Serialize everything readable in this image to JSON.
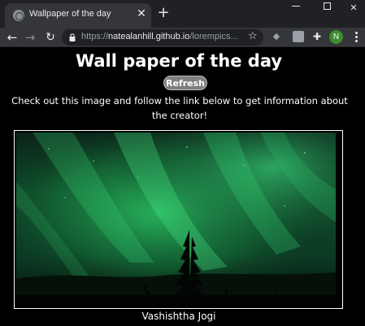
{
  "browser": {
    "tab_title": "Wallpaper of the day",
    "url_host": "natealanhill.github.io",
    "url_path": "/lorempics...",
    "url_scheme": "https://",
    "avatar_initial": "N"
  },
  "page": {
    "title": "Wall paper of the day",
    "refresh_label": "Refresh",
    "description": "Check out this image and follow the link below to get information about the creator!",
    "credit": "Vashishtha Jogi"
  },
  "colors": {
    "aurora": "#1f9a4a",
    "refresh_bg": "#808080"
  }
}
